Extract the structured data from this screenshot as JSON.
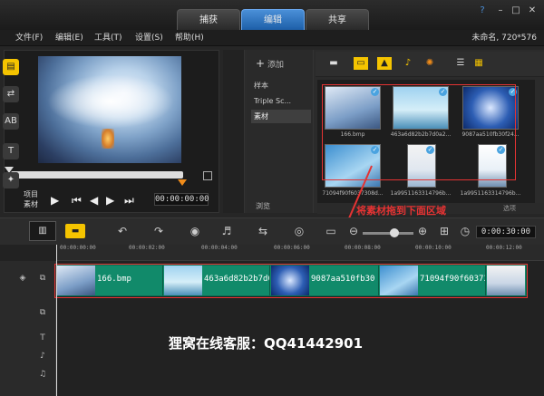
{
  "tabs": [
    {
      "label": "捕获"
    },
    {
      "label": "编辑"
    },
    {
      "label": "共享"
    }
  ],
  "window": {
    "help": "?",
    "minimize": "–",
    "maximize": "□",
    "close": "✕"
  },
  "menu": [
    "文件(F)",
    "编辑(E)",
    "工具(T)",
    "设置(S)",
    "帮助(H)"
  ],
  "project_info": "未命名, 720*576",
  "player": {
    "label_project": "项目",
    "label_clip": "素材",
    "timecode": "00:00:00:00"
  },
  "library": {
    "add_label": "添加",
    "folders": [
      "样本",
      "Triple Sc...",
      "素材"
    ],
    "browse_label": "浏览",
    "options_label": "选项"
  },
  "thumbnails": [
    {
      "label": "166.bmp"
    },
    {
      "label": "463a6d82b2b7d0a2..."
    },
    {
      "label": "9087aa510fb30f24..."
    },
    {
      "label": "71094f90f6037308d..."
    },
    {
      "label": "1a9951163314796b..."
    },
    {
      "label": "1a9951163314796b..."
    }
  ],
  "instruction": "将素材拖到下面区域",
  "timeline": {
    "duration": "0:00:30:00",
    "ticks": [
      "00:00:00:00",
      "00:00:02:00",
      "00:00:04:00",
      "00:00:06:00",
      "00:00:08:00",
      "00:00:10:00",
      "00:00:12:00"
    ],
    "clips": [
      {
        "label": "166.bmp"
      },
      {
        "label": "463a6d82b2b7d0"
      },
      {
        "label": "9087aa510fb30"
      },
      {
        "label": "71094f90f60373"
      },
      {
        "label": ""
      }
    ]
  },
  "watermark": "狸窝在线客服：QQ41442901",
  "colors": {
    "accent": "#1d5fa8",
    "highlight": "#e53333",
    "clip": "#118a6a",
    "folder_icon": "#f5c400"
  }
}
